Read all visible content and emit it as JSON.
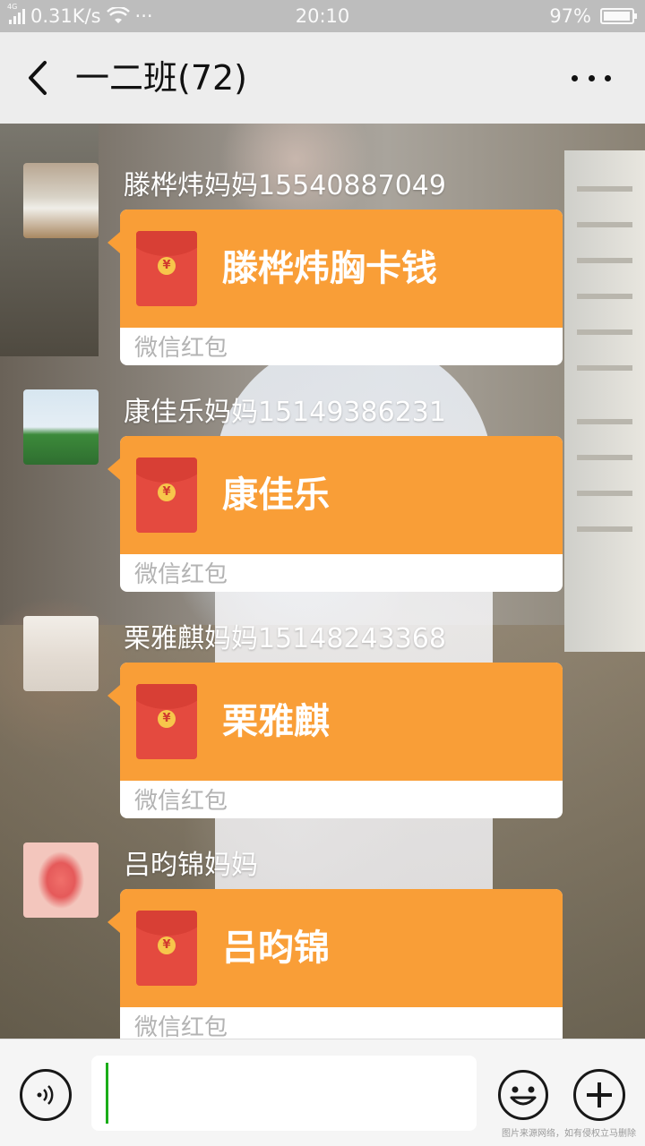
{
  "status_bar": {
    "network": "4G",
    "speed": "0.31K/s",
    "more": "···",
    "time": "20:10",
    "battery_text": "97%",
    "battery_level": 0.97
  },
  "header": {
    "title": "一二班(72)",
    "back_icon": "chevron-left-icon",
    "more_icon": "more-dots-icon"
  },
  "messages": [
    {
      "sender": "滕桦炜妈妈15540887049",
      "packet_title": "滕桦炜胸卡钱",
      "packet_footer": "微信红包"
    },
    {
      "sender": "康佳乐妈妈15149386231",
      "packet_title": "康佳乐",
      "packet_footer": "微信红包"
    },
    {
      "sender": "栗雅麒妈妈15148243368",
      "packet_title": "栗雅麒",
      "packet_footer": "微信红包"
    },
    {
      "sender": "吕昀锦妈妈",
      "packet_title": "吕昀锦",
      "packet_footer": "微信红包"
    }
  ],
  "input_bar": {
    "voice_icon": "voice-icon",
    "emoji_icon": "emoji-icon",
    "plus_icon": "plus-circle-icon",
    "input_value": ""
  },
  "watermark": "图片来源网络，如有侵权立马删除",
  "colors": {
    "packet_orange": "#f99e37",
    "envelope_red": "#e44a3f",
    "caret_green": "#1aad19"
  }
}
